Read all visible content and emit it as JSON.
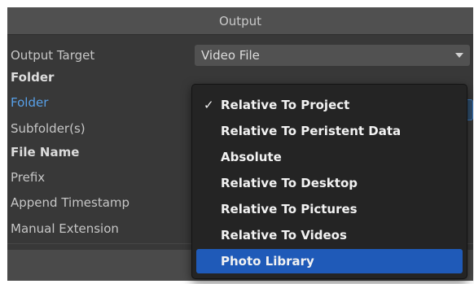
{
  "header": {
    "title": "Output"
  },
  "fields": {
    "output_target_label": "Output Target",
    "output_target_value": "Video File",
    "folder_section": "Folder",
    "folder_label": "Folder",
    "subfolder_label": "Subfolder(s)",
    "file_name_section": "File Name",
    "prefix_label": "Prefix",
    "append_timestamp_label": "Append Timestamp",
    "manual_extension_label": "Manual Extension"
  },
  "dropdown": {
    "checkmark": "✓",
    "items": [
      {
        "label": "Relative To Project",
        "checked": true
      },
      {
        "label": "Relative To Peristent Data"
      },
      {
        "label": "Absolute"
      },
      {
        "label": "Relative To Desktop"
      },
      {
        "label": "Relative To Pictures"
      },
      {
        "label": "Relative To Videos"
      },
      {
        "label": "Photo Library",
        "highlighted": true
      }
    ]
  },
  "colors": {
    "panel_bg": "#383838",
    "accent_blue": "#58a0e8",
    "highlight": "#1f5ab8",
    "menu_bg": "#242424"
  }
}
